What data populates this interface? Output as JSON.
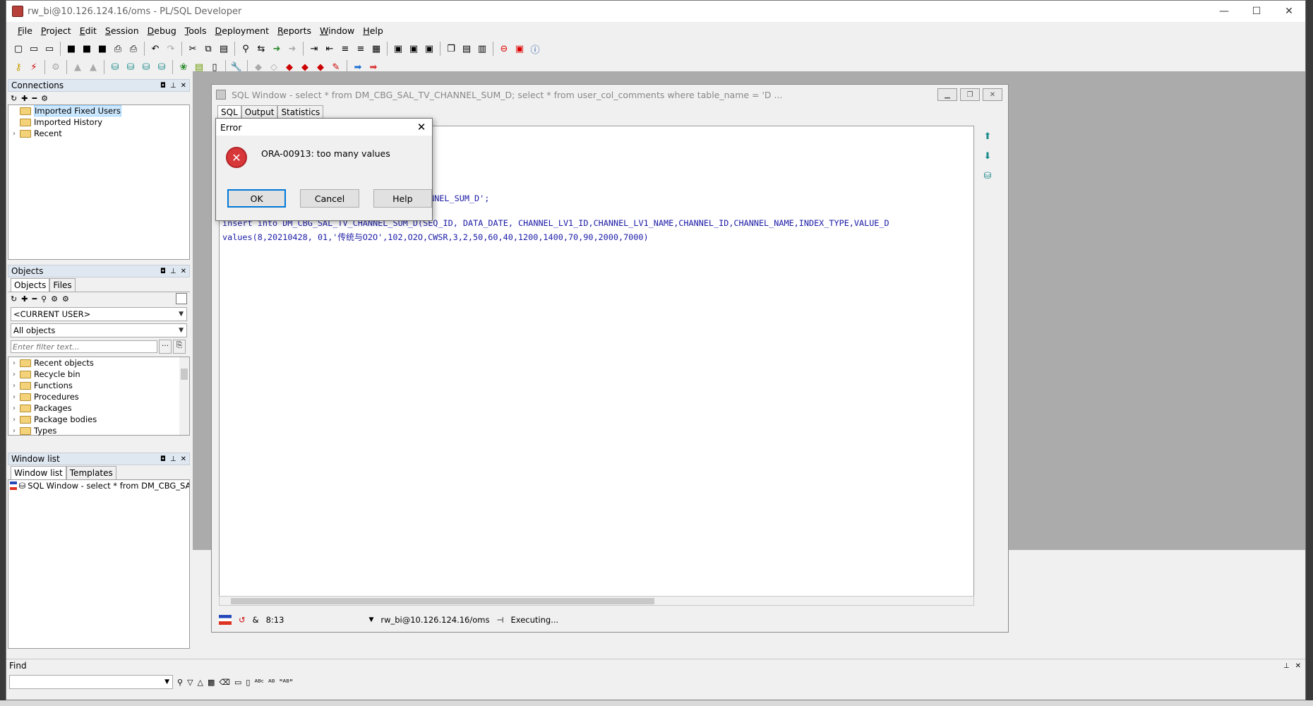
{
  "window": {
    "title": "rw_bi@10.126.124.16/oms - PL/SQL Developer",
    "minimize": "—",
    "maximize": "☐",
    "close": "✕"
  },
  "menu": [
    "File",
    "Project",
    "Edit",
    "Session",
    "Debug",
    "Tools",
    "Deployment",
    "Reports",
    "Window",
    "Help"
  ],
  "connections": {
    "header": "Connections",
    "items": [
      "Imported Fixed Users",
      "Imported History",
      "Recent"
    ]
  },
  "objects": {
    "header": "Objects",
    "tabs": [
      "Objects",
      "Files"
    ],
    "user_select": "<CURRENT USER>",
    "filter_select": "All objects",
    "filter_placeholder": "Enter filter text...",
    "items": [
      "Recent objects",
      "Recycle bin",
      "Functions",
      "Procedures",
      "Packages",
      "Package bodies",
      "Types"
    ]
  },
  "window_list": {
    "header": "Window list",
    "tabs": [
      "Window list",
      "Templates"
    ],
    "items": [
      "SQL Window - select * from DM_CBG_SAL"
    ]
  },
  "sql_window": {
    "title": "SQL Window - select * from DM_CBG_SAL_TV_CHANNEL_SUM_D; select * from user_col_comments where table_name = 'D ...",
    "tabs": [
      "SQL",
      "Output",
      "Statistics"
    ],
    "code_fragment": "ANNEL_SUM_D';",
    "code_line1": "insert into DM_CBG_SAL_TV_CHANNEL_SUM_D(SEQ_ID, DATA_DATE, CHANNEL_LV1_ID,CHANNEL_LV1_NAME,CHANNEL_ID,CHANNEL_NAME,INDEX_TYPE,VALUE_D",
    "code_line2": "values(8,20210428, 01,'传统与O2O',102,O2O,CWSR,3,2,50,60,40,1200,1400,70,90,2000,7000)",
    "status_position": "8:13",
    "status_connection": "rw_bi@10.126.124.16/oms",
    "status_state": "Executing..."
  },
  "dialog": {
    "title": "Error",
    "message": "ORA-00913: too many values",
    "buttons": {
      "ok": "OK",
      "cancel": "Cancel",
      "help": "Help"
    }
  },
  "find": {
    "header": "Find"
  },
  "colors": {
    "code": "#1a1aa6",
    "error": "#d8373a",
    "panel_header": "#dfe7f1"
  }
}
